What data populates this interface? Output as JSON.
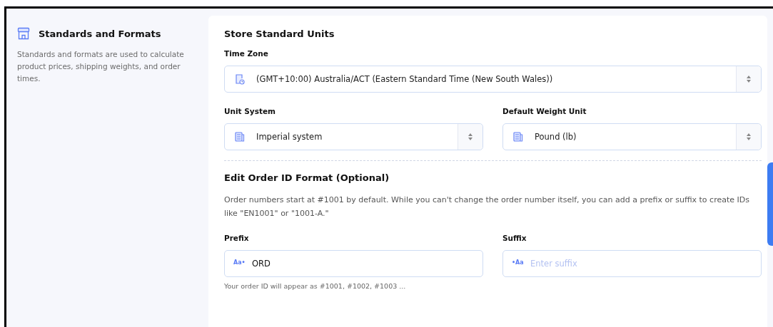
{
  "sidebar": {
    "title": "Standards and Formats",
    "description": "Standards and formats are used to calculate product prices, shipping weights, and order times."
  },
  "units": {
    "title": "Store Standard Units",
    "time_zone": {
      "label": "Time Zone",
      "value": "(GMT+10:00) Australia/ACT (Eastern Standard Time (New South Wales))"
    },
    "unit_system": {
      "label": "Unit System",
      "value": "Imperial system"
    },
    "weight_unit": {
      "label": "Default Weight Unit",
      "value": "Pound (lb)"
    }
  },
  "order_id": {
    "title": "Edit Order ID Format (Optional)",
    "description": "Order numbers start at #1001 by default. While you can't change the order number itself, you can add a prefix or suffix to create IDs like \"EN1001\" or \"1001-A.\"",
    "prefix": {
      "label": "Prefix",
      "mark": "Aa•",
      "value": "ORD",
      "hint": "Your order ID will appear as #1001, #1002, #1003 ..."
    },
    "suffix": {
      "label": "Suffix",
      "mark": "•Aa",
      "placeholder": "Enter suffix"
    }
  }
}
